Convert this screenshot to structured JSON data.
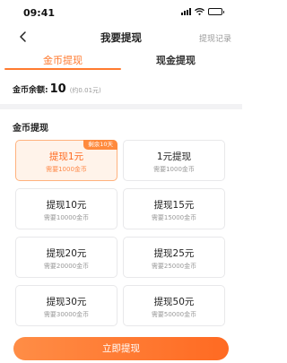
{
  "status_bar": {
    "time": "09:41"
  },
  "nav": {
    "title": "我要提现",
    "record_link": "提现记录"
  },
  "tabs": [
    {
      "label": "金币提现",
      "active": true
    },
    {
      "label": "现金提现",
      "active": false
    }
  ],
  "balance": {
    "label": "金币余额:",
    "value": "10",
    "note": "(约0.01元)"
  },
  "section": {
    "title": "金币提现"
  },
  "options": [
    {
      "title": "提现1元",
      "sub": "需要1000金币",
      "badge": "剩余10天",
      "selected": true
    },
    {
      "title": "1元提现",
      "sub": "需要1000金币",
      "badge": "",
      "selected": false
    },
    {
      "title": "提现10元",
      "sub": "需要10000金币",
      "badge": "",
      "selected": false
    },
    {
      "title": "提现15元",
      "sub": "需要15000金币",
      "badge": "",
      "selected": false
    },
    {
      "title": "提现20元",
      "sub": "需要20000金币",
      "badge": "",
      "selected": false
    },
    {
      "title": "提现25元",
      "sub": "需要25000金币",
      "badge": "",
      "selected": false
    },
    {
      "title": "提现30元",
      "sub": "需要30000金币",
      "badge": "",
      "selected": false
    },
    {
      "title": "提现50元",
      "sub": "需要50000金币",
      "badge": "",
      "selected": false
    }
  ],
  "submit": {
    "label": "立即提现"
  },
  "colors": {
    "accent": "#ff7a2f",
    "selected_bg": "#fff3ea",
    "divider": "#f2f2f4"
  }
}
